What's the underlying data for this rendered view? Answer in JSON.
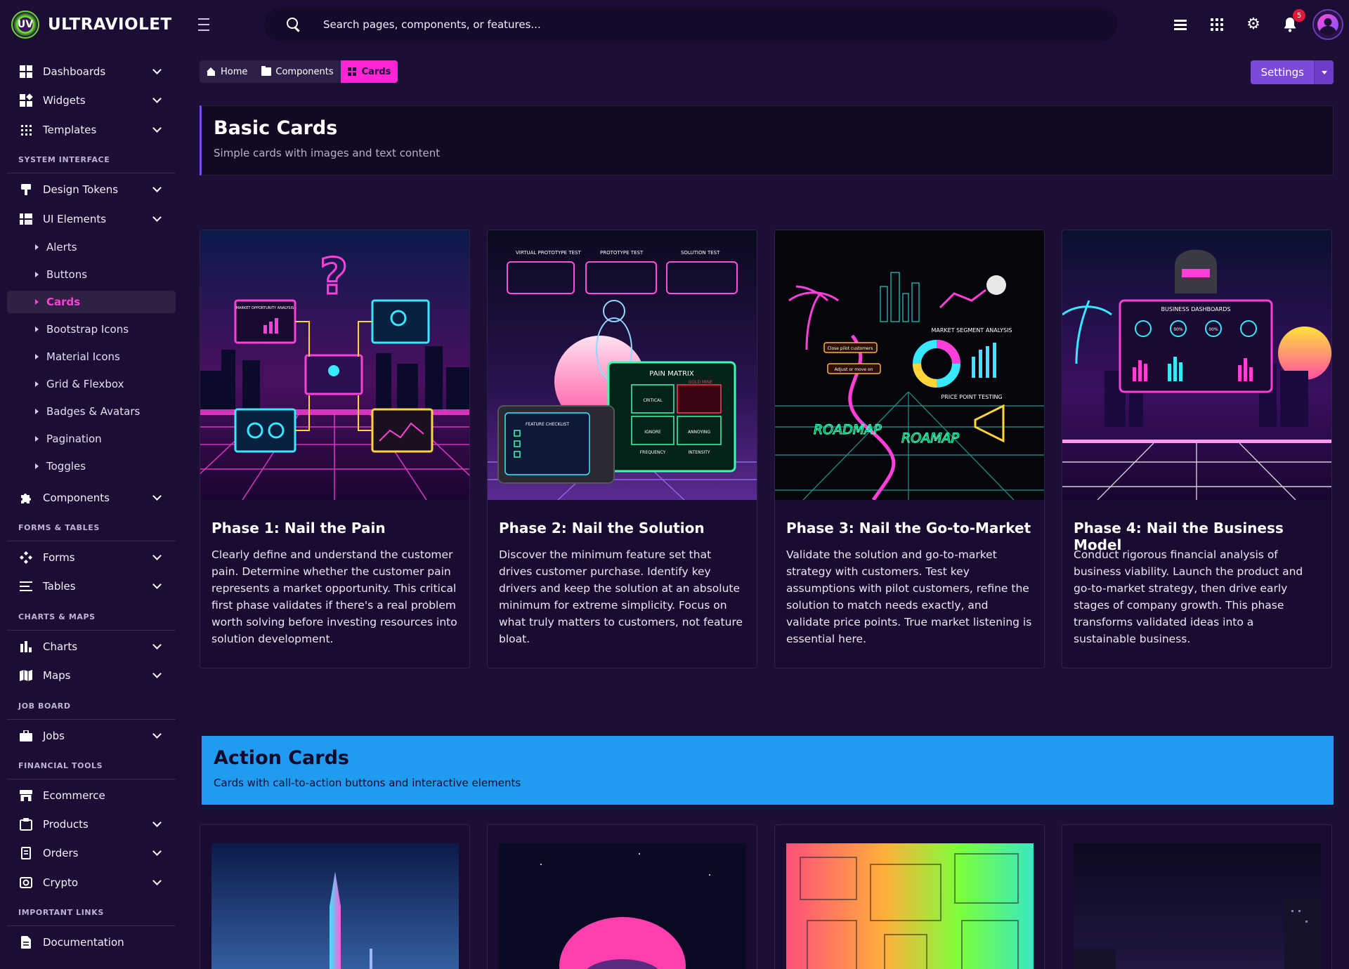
{
  "app": {
    "brand_name": "ULTRAVIOLET",
    "brand_logo_text": "UV"
  },
  "search": {
    "placeholder": "Search pages, components, or features..."
  },
  "header": {
    "notification_count": "5"
  },
  "sidebar": {
    "top_items": [
      {
        "label": "Dashboards",
        "icon": "dashboard-icon"
      },
      {
        "label": "Widgets",
        "icon": "widgets-icon"
      },
      {
        "label": "Templates",
        "icon": "templates-icon"
      }
    ],
    "system_interface": {
      "heading": "SYSTEM INTERFACE",
      "items": [
        {
          "label": "Design Tokens",
          "icon": "paint-icon"
        },
        {
          "label": "UI Elements",
          "icon": "ui-elements-icon"
        }
      ],
      "ui_elements_children": [
        {
          "label": "Alerts"
        },
        {
          "label": "Buttons"
        },
        {
          "label": "Cards",
          "active": true
        },
        {
          "label": "Bootstrap Icons"
        },
        {
          "label": "Material Icons"
        },
        {
          "label": "Grid & Flexbox"
        },
        {
          "label": "Badges & Avatars"
        },
        {
          "label": "Pagination"
        },
        {
          "label": "Toggles"
        }
      ],
      "components_label": "Components"
    },
    "forms_tables": {
      "heading": "FORMS & TABLES",
      "items": [
        {
          "label": "Forms"
        },
        {
          "label": "Tables"
        }
      ]
    },
    "charts_maps": {
      "heading": "CHARTS & MAPS",
      "items": [
        {
          "label": "Charts"
        },
        {
          "label": "Maps"
        }
      ]
    },
    "job_board": {
      "heading": "JOB BOARD",
      "items": [
        {
          "label": "Jobs"
        }
      ]
    },
    "financial_tools": {
      "heading": "FINANCIAL TOOLS",
      "items": [
        {
          "label": "Ecommerce"
        },
        {
          "label": "Products"
        },
        {
          "label": "Orders"
        },
        {
          "label": "Crypto"
        }
      ]
    },
    "important_links": {
      "heading": "IMPORTANT LINKS",
      "items": [
        {
          "label": "Documentation"
        }
      ]
    }
  },
  "breadcrumb": {
    "home": "Home",
    "components": "Components",
    "current": "Cards"
  },
  "settings_button": "Settings",
  "basic_section": {
    "title": "Basic Cards",
    "subtitle": "Simple cards with images and text content"
  },
  "cards": [
    {
      "title": "Phase 1: Nail the Pain",
      "text": "Clearly define and understand the customer pain. Determine whether the customer pain represents a market opportunity. This critical first phase validates if there's a real problem worth solving before investing resources into solution development.",
      "image_labels": [
        "MARKET OPPORTUNITY ANALYSIS"
      ]
    },
    {
      "title": "Phase 2: Nail the Solution",
      "text": "Discover the minimum feature set that drives customer purchase. Identify key drivers and keep the solution at an absolute minimum for extreme simplicity. Focus on what truly matters to customers, not feature bloat.",
      "image_labels": [
        "VIRTUAL PROTOTYPE TEST",
        "PROTOTYPE TEST",
        "SOLUTION TEST",
        "PAIN MATRIX",
        "GOLD MINE",
        "CRITICAL",
        "IGNORE",
        "ANNOYING",
        "FREQUENCY",
        "INTENSITY",
        "FEATURE CHECKLIST"
      ]
    },
    {
      "title": "Phase 3: Nail the Go-to-Market",
      "text": "Validate the solution and go-to-market strategy with customers. Test key assumptions with pilot customers, refine the solution to match needs exactly, and validate price points. True market listening is essential here.",
      "image_labels": [
        "MARKET SEGMENT ANALYSIS",
        "PRICE POINT TESTING",
        "ROADMAP",
        "ROAMAP",
        "Close pilot customers",
        "Adjust or move on"
      ]
    },
    {
      "title": "Phase 4: Nail the Business Model",
      "text": "Conduct rigorous financial analysis of business viability. Launch the product and go-to-market strategy, then drive early stages of company growth. This phase transforms validated ideas into a sustainable business.",
      "image_labels": [
        "BUSINESS DASHBOARDS",
        "00%",
        "00%"
      ]
    }
  ],
  "action_section": {
    "title": "Action Cards",
    "subtitle": "Cards with call-to-action buttons and interactive elements"
  },
  "colors": {
    "background": "#1d0e35",
    "sidebar": "#1b0d33",
    "accent_pink": "#ff24d6",
    "accent_purple": "#7b4ad9",
    "action_banner": "#1f9cf0"
  }
}
